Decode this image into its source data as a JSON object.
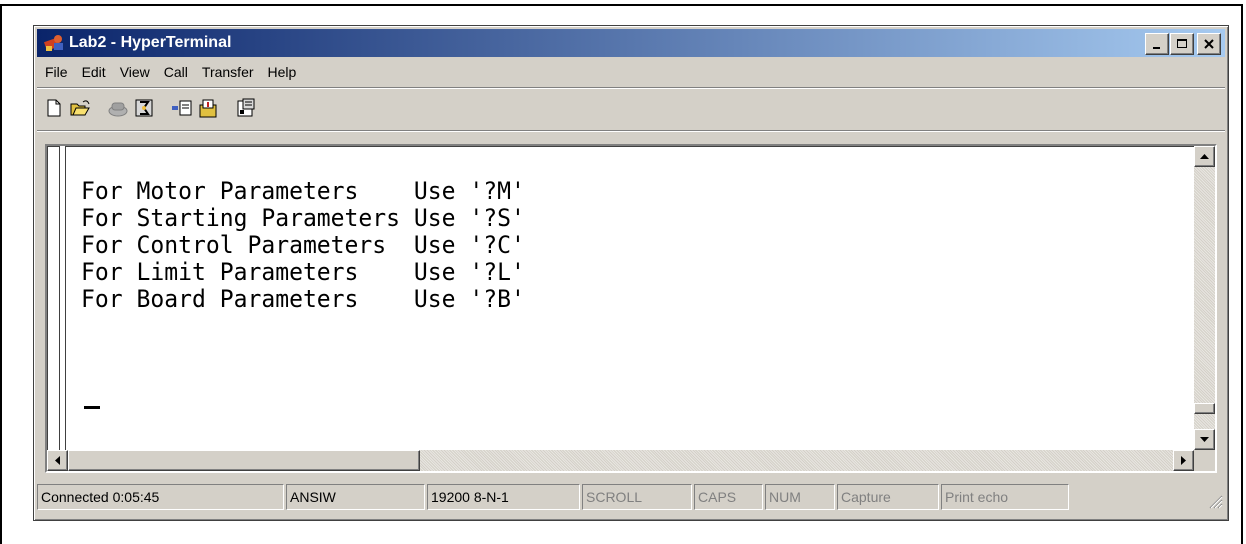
{
  "window": {
    "title": "Lab2 - HyperTerminal",
    "app_icon": "hyperterminal-icon",
    "controls": {
      "minimize": "_",
      "maximize": "□",
      "close": "×"
    }
  },
  "menubar": {
    "items": [
      "File",
      "Edit",
      "View",
      "Call",
      "Transfer",
      "Help"
    ]
  },
  "toolbar": {
    "buttons": [
      "new-icon",
      "open-icon",
      "connect-icon",
      "disconnect-icon",
      "send-icon",
      "receive-icon",
      "properties-icon"
    ]
  },
  "terminal": {
    "lines": [
      "For Motor Parameters    Use '?M'",
      "For Starting Parameters Use '?S'",
      "For Control Parameters  Use '?C'",
      "For Limit Parameters    Use '?L'",
      "For Board Parameters    Use '?B'"
    ]
  },
  "statusbar": {
    "connected": "Connected 0:05:45",
    "emulation": "ANSIW",
    "settings": "19200 8-N-1",
    "scroll": "SCROLL",
    "caps": "CAPS",
    "num": "NUM",
    "capture": "Capture",
    "print_echo": "Print echo"
  }
}
